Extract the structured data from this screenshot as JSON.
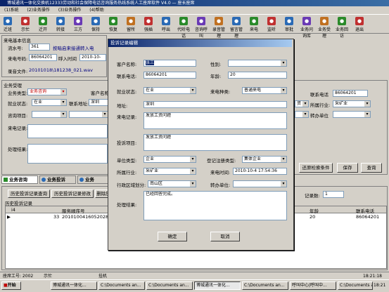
{
  "window": {
    "title": "博城通讯一体化交换机12333劳动和社会保障电话咨询服务热线系统人工座席软件 V4.0 — 座长座席"
  },
  "menu": [
    "(1)系统",
    "(2)业务操作",
    "(3)业务操作",
    "(4)帮助"
  ],
  "toolbar": [
    {
      "label": "迁班",
      "color": "#2a6ab5"
    },
    {
      "label": "示忙",
      "color": "#c03030"
    },
    {
      "label": "迁开",
      "color": "#2a8a2a"
    },
    {
      "label": "转接",
      "color": "#2a6ab5"
    },
    {
      "label": "三方",
      "color": "#6a3ab5"
    },
    {
      "label": "保持",
      "color": "#2a6ab5"
    },
    {
      "label": "恢复",
      "color": "#2a8a2a"
    },
    {
      "label": "留所",
      "color": "#c07020"
    },
    {
      "label": "强插",
      "color": "#c03030"
    },
    {
      "label": "呼出",
      "color": "#2a6ab5"
    },
    {
      "label": "代听电话",
      "color": "#2a8a2a"
    },
    {
      "label": "咨询呼叫",
      "color": "#6a3ab5"
    },
    {
      "label": "录音管理",
      "color": "#c07020"
    },
    {
      "label": "留言管理",
      "color": "#2a6ab5"
    },
    {
      "label": "来电",
      "color": "#2a8a2a"
    },
    {
      "label": "监听",
      "color": "#c03030"
    },
    {
      "label": "审批",
      "color": "#2a6ab5"
    },
    {
      "label": "业务问询库",
      "color": "#6a3ab5"
    },
    {
      "label": "业务受理",
      "color": "#c07020"
    },
    {
      "label": "业务回访",
      "color": "#2a8a2a"
    },
    {
      "label": "退出",
      "color": "#c03030"
    }
  ],
  "caller_info": {
    "section": "来电基本信息",
    "seq_label": "流水号:",
    "seq_value": "361",
    "prompt": "按暗启来接通转入电",
    "phone_label": "来电号码:",
    "phone_value": "86064201",
    "time_label": "呼入时间",
    "time_value": "2010-10-",
    "rec_label": "录音文件:",
    "rec_value": "20101018\\181238_021.wav"
  },
  "business": {
    "section": "业务受理",
    "type_label": "业务类型:",
    "type_value": "业务咨询",
    "client_label": "客户名称",
    "job_label": "就业状态:",
    "job_value": "在业",
    "addr_label": "联系地址:",
    "addr_value": "深圳",
    "consult_label": "咨询项目:",
    "record_label": "来电记录:",
    "result_label": "处理结果:",
    "phone_label": "联系电话",
    "phone_value": "86064201",
    "industry_label": "所属行业:",
    "industry_value": "采矿业",
    "transfer_label": "转办单位",
    "extra_value": "资",
    "btn_restore": "还原检索条件",
    "btn_save": "保存",
    "btn_query": "查询"
  },
  "tabs": {
    "t1": "业务咨询",
    "t2": "业务投诉",
    "t3": "业务"
  },
  "subtabs": {
    "s1": "历史投诉记录查询",
    "s2": "历史投诉记录修改",
    "s3": "删除历"
  },
  "record_count_label": "记录数:",
  "record_count_value": "1",
  "grid": {
    "title": "历史投诉记录",
    "headers": [
      "i4",
      "服务顺序号",
      "年龄",
      "联系电话"
    ],
    "rows": [
      [
        "33",
        "20101004160520282002",
        "20",
        "86064201"
      ]
    ]
  },
  "dialog": {
    "title": "投诉记录编辑",
    "name_label": "客户名称:",
    "name_value": "张三",
    "gender_label": "性别:",
    "gender_value": "",
    "phone_label": "联系电话:",
    "phone_value": "86064201",
    "age_label": "年龄:",
    "age_value": "20",
    "job_label": "就业状态:",
    "job_value": "在业",
    "calltype_label": "来电种类:",
    "calltype_value": "普通来电",
    "addr_label": "地址:",
    "addr_value": "深圳",
    "record_label": "来电记录:",
    "record_value": "发放工资问题",
    "complaint_label": "投诉项目:",
    "complaint_value": "发放工资问题",
    "unit_label": "单位类型:",
    "unit_value": "企业",
    "reg_label": "登记注册类型:",
    "reg_value": "集体企业",
    "industry_label": "所属行业:",
    "industry_value": "采矿业",
    "calltime_label": "来电时间:",
    "calltime_value": "2010-10-4 17:54:36",
    "region_label": "行政区域划分:",
    "region_value": "南山区",
    "transfer_label": "转办单位:",
    "transfer_value": "",
    "result_label": "处理结果:",
    "result_value": "已经回答完成。",
    "ok": "确定",
    "cancel": "取消"
  },
  "status": {
    "agent": "座席工号: 2002",
    "state": "示忙",
    "device": "挂机",
    "time": "18:21:18"
  },
  "taskbar": {
    "start": "开始",
    "tasks": [
      "博城通讯一体化...",
      "C:\\Documents an...",
      "C:\\Documents an...",
      "博城通讯一体化...",
      "C:\\Documents an...",
      "呼叫中心|呼叫中...",
      "C:\\Documents an..."
    ],
    "clock": "18:21"
  }
}
